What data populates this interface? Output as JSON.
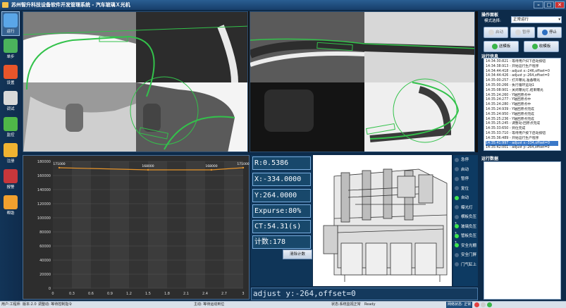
{
  "app": {
    "title": "苏州智升科技设备软件开发管理系统 - 汽车玻璃Ｘ光机"
  },
  "window": {
    "min": "–",
    "max": "□",
    "close": "✕"
  },
  "sidebar": {
    "items": [
      {
        "label": "运行",
        "icon": "monitor-icon",
        "active": true,
        "color": "#5aa6e8"
      },
      {
        "label": "单步",
        "icon": "bar-chart-icon",
        "color": "#4bb35c"
      },
      {
        "label": "设置",
        "icon": "gear-icon",
        "color": "#e8552a"
      },
      {
        "label": "调试",
        "icon": "document-icon",
        "color": "#d9d9d9"
      },
      {
        "label": "监控",
        "icon": "monitor-green-icon",
        "color": "#4fb848"
      },
      {
        "label": "注册",
        "icon": "key-icon",
        "color": "#f0b331"
      },
      {
        "label": "报警",
        "icon": "alarm-icon",
        "color": "#c6373b"
      },
      {
        "label": "帮助",
        "icon": "help-icon",
        "color": "#f0a02e"
      }
    ]
  },
  "chart_data": {
    "type": "line",
    "x": [
      0.1,
      1.5,
      2.5,
      3.0
    ],
    "series": [
      {
        "values": [
          171000,
          168000,
          168000,
          171000
        ],
        "color": "#e8952a"
      }
    ],
    "point_labels": [
      "171000",
      "168000",
      "168000",
      "171000"
    ],
    "xlim": [
      0,
      3
    ],
    "ylim": [
      0,
      180000
    ],
    "xticks": [
      "0",
      "0.3",
      "0.6",
      "0.9",
      "1.2",
      "1.5",
      "1.8",
      "2.1",
      "2.4",
      "2.7",
      "3"
    ],
    "yticks": [
      "0",
      "20000",
      "40000",
      "60000",
      "80000",
      "100000",
      "120000",
      "140000",
      "160000",
      "180000"
    ],
    "grid": true
  },
  "readouts": {
    "r": "R:0.5386",
    "x": "X:-334.0000",
    "y": "Y:264.0000",
    "expurse": "Expurse:80%",
    "ct": "CT:54.31(s)",
    "count": "计数:178"
  },
  "clear_button": "清除计数",
  "io_status": [
    {
      "label": "急停",
      "on": false
    },
    {
      "label": "启动",
      "on": false
    },
    {
      "label": "暂停",
      "on": false
    },
    {
      "label": "复位",
      "on": false
    },
    {
      "label": "自动",
      "on": true
    },
    {
      "label": "曝光灯",
      "on": false
    },
    {
      "label": "横板负压1",
      "on": false
    },
    {
      "label": "玻璃负压1",
      "on": true
    },
    {
      "label": "管板负压1",
      "on": true
    },
    {
      "label": "安全光栅",
      "on": true
    },
    {
      "label": "安全门屏",
      "on": false
    },
    {
      "label": "门气缸上",
      "on": false
    }
  ],
  "log_bar": "adjust y:-264,offset=0",
  "right": {
    "panel_title": "操作面板",
    "mode_label": "模式选择:",
    "mode_value": "正常运行",
    "btn_start": "启动",
    "btn_pause": "暂停",
    "btn_stop": "停止",
    "btn_load": "送模板",
    "btn_collect": "收模板",
    "log_title": "运行信息",
    "data_title": "运行数据"
  },
  "log_lines": [
    "14:34:30:821 - 等待用户扫下启动按钮",
    "14:34:38:913 - 开始运行生产程序",
    "14:34:44:418 - adjust x:-246,offset=0",
    "14:34:44:426 - adjust y:-264,offset=0",
    "14:35:00:257 - 打开曝光,准备曝光",
    "14:35:00:266 - 执行循环运动1",
    "14:35:08:901 - 关闭曝光灯,结束曝光",
    "14:35:24:260 - Y轴回原点中",
    "14:35:24:277 - Y轴回原点中",
    "14:35:24:280 - Y轴回原点中",
    "14:35:24:939 - Y轴回原点完成",
    "14:35:24:950 - Y轴回原点完成",
    "14:35:25:236 - Y轴回原点完成",
    "14:35:25:245 - 调整动:回原点完成",
    "14:35:33:650 - 到位完成",
    "14:35:33:710 - 等待用户按下启动按钮",
    "14:35:36:489 - 开始运行生产程序",
    "14:35:41:997 - adjust x:-334,offset=0",
    "14:35:42:001 - adjust y:-264,offset=0"
  ],
  "status": {
    "left1": "用户:工程师",
    "left2": "版本:2.0",
    "left3": "调整动: 等待控制指令",
    "mid": "主动: 等待运动到位",
    "state": "状态:系统监视正常",
    "ready": "Ready",
    "net": "网络状态: 正常"
  }
}
